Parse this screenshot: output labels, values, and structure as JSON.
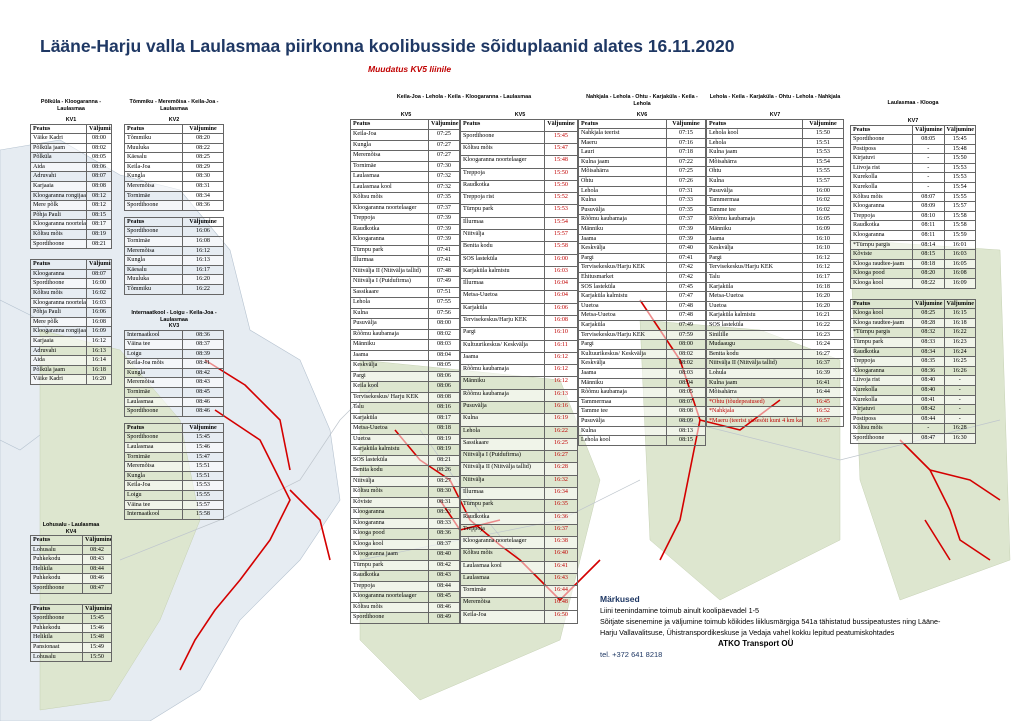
{
  "title": "Lääne-Harju valla Laulasmaa piirkonna koolibusside sõiduplaanid alates 16.11.2020",
  "subtitle": "Muudatus KV5 liinile",
  "col": {
    "stop": "Peatus",
    "dep": "Väljumine"
  },
  "kv1": {
    "route": "Põlküla - Kloogaranna - Laulasmaa",
    "code": "KV1",
    "rows": [
      [
        "Väike Kadri",
        "08:00"
      ],
      [
        "Põlküla jaam",
        "08:02"
      ],
      [
        "Põlküla",
        "08:05"
      ],
      [
        "Aida",
        "08:06"
      ],
      [
        "Adruvahi",
        "08:07"
      ],
      [
        "Karjaaia",
        "08:08"
      ],
      [
        "Kloogaranna rongijaam",
        "08:12"
      ],
      [
        "Mere põlk",
        "08:12"
      ],
      [
        "Põhja Pauli",
        "08:15"
      ],
      [
        "Kloogaranna noortelaager",
        "08:17"
      ],
      [
        "Kõltsu mõis",
        "08:19"
      ],
      [
        "Spordihoone",
        "08:21"
      ]
    ]
  },
  "kv1b": {
    "rows": [
      [
        "Kloogaranna",
        "08:07"
      ],
      [
        "Spordihoone",
        "16:00"
      ],
      [
        "Kõltsu mõis",
        "16:02"
      ],
      [
        "Kloogaranna noortelaager",
        "16:03"
      ],
      [
        "Põhja Pauli",
        "16:06"
      ],
      [
        "Mere põlk",
        "16:08"
      ],
      [
        "Kloogaranna rongijaam",
        "16:09"
      ],
      [
        "Karjaaia",
        "16:12"
      ],
      [
        "Adruvahi",
        "16:13"
      ],
      [
        "Aida",
        "16:14"
      ],
      [
        "Põlküla jaam",
        "16:18"
      ],
      [
        "Väike Kadri",
        "16:20"
      ]
    ]
  },
  "kv4": {
    "route": "Lohusalu - Laulasmaa",
    "code": "KV4",
    "rows": [
      [
        "Lohusalu",
        "08:42"
      ],
      [
        "Puhkekodu",
        "08:43"
      ],
      [
        "Helikila",
        "08:44"
      ],
      [
        "Puhkekodu",
        "08:46"
      ],
      [
        "Spordihoone",
        "08:47"
      ]
    ],
    "rows2": [
      [
        "Spordihoone",
        "15:45"
      ],
      [
        "Puhkekodu",
        "15:46"
      ],
      [
        "Helikila",
        "15:48"
      ],
      [
        "Pansionaat",
        "15:49"
      ],
      [
        "Lohusalu",
        "15:50"
      ]
    ]
  },
  "kv2": {
    "route": "Tõmmiku - Meremõisa - Keila-Joa - Laulasmaa",
    "code": "KV2",
    "rows": [
      [
        "Tõmmiku",
        "08:20"
      ],
      [
        "Muuluka",
        "08:22"
      ],
      [
        "Käesalu",
        "08:25"
      ],
      [
        "Keila-Joa",
        "08:29"
      ],
      [
        "Kungla",
        "08:30"
      ],
      [
        "Meremõisa",
        "08:31"
      ],
      [
        "Tornimäe",
        "08:34"
      ],
      [
        "Spordihoone",
        "08:36"
      ]
    ],
    "rows2": [
      [
        "Spordihoone",
        "16:06"
      ],
      [
        "Tornimäe",
        "16:08"
      ],
      [
        "Meremõisa",
        "16:12"
      ],
      [
        "Kungla",
        "16:13"
      ],
      [
        "Käesalu",
        "16:17"
      ],
      [
        "Muuluka",
        "16:20"
      ],
      [
        "Tõmmiku",
        "16:22"
      ]
    ]
  },
  "kv3": {
    "route": "Internaatkool - Loigu - Keila-Joa - Laulasmaa",
    "code": "KV3",
    "rows": [
      [
        "Internaatkool",
        "08:36"
      ],
      [
        "Väina tee",
        "08:37"
      ],
      [
        "Loigu",
        "08:39"
      ],
      [
        "Keila-Joa mõis",
        "08:41"
      ],
      [
        "Kungla",
        "08:42"
      ],
      [
        "Meremõisa",
        "08:43"
      ],
      [
        "Tornimäe",
        "08:45"
      ],
      [
        "Laulasmaa",
        "08:46"
      ],
      [
        "Spordihoone",
        "08:46"
      ]
    ],
    "rows2": [
      [
        "Spordihoone",
        "15:45"
      ],
      [
        "Laulasmaa",
        "15:46"
      ],
      [
        "Tornimäe",
        "15:47"
      ],
      [
        "Meremõisa",
        "15:51"
      ],
      [
        "Kungla",
        "15:51"
      ],
      [
        "Keila-Joa",
        "15:53"
      ],
      [
        "Loigu",
        "15:55"
      ],
      [
        "Väina tee",
        "15:57"
      ],
      [
        "Internaatkool",
        "15:58"
      ]
    ]
  },
  "kv5": {
    "route": "Keila-Joa - Lehola - Keila - Kloogaranna - Laulasmaa",
    "code": "KV5",
    "rows": [
      [
        "Keila-Joa",
        "07:25"
      ],
      [
        "Kungla",
        "07:27"
      ],
      [
        "Meremõisa",
        "07:27"
      ],
      [
        "Tornimäe",
        "07:30"
      ],
      [
        "Laulasmaa",
        "07:32"
      ],
      [
        "Laulasmaa kool",
        "07:32"
      ],
      [
        "Kõltsu mõis",
        "07:35"
      ],
      [
        "Kloogaranna noortelaager",
        "07:37"
      ],
      [
        "Treppoja",
        "07:39"
      ],
      [
        "Raudkotka",
        "07:39"
      ],
      [
        "Kloogaranna",
        "07:39"
      ],
      [
        "Türnpu park",
        "07:41"
      ],
      [
        "Illurmaa",
        "07:41"
      ],
      [
        "Niitvälja II (Niitvälja tallid)",
        "07:48"
      ],
      [
        "Niitvälja I (Puidufirma)",
        "07:49"
      ],
      [
        "Sassikaare",
        "07:51"
      ],
      [
        "Lehola",
        "07:55"
      ],
      [
        "Kulna",
        "07:56"
      ],
      [
        "Pusuvälja",
        "08:00"
      ],
      [
        "Rõõmu kaubamaja",
        "08:02"
      ],
      [
        "Männiku",
        "08:03"
      ],
      [
        "Jaama",
        "08:04"
      ],
      [
        "Keskvälja",
        "08:05"
      ],
      [
        "Pargi",
        "08:06"
      ],
      [
        "Keila kool",
        "08:06"
      ],
      [
        "Tervisekeskus/ Harju KEK",
        "08:08"
      ],
      [
        "Talu",
        "08:16"
      ],
      [
        "Karjaküla",
        "08:17"
      ],
      [
        "Metsa-Uuetoa",
        "08:18"
      ],
      [
        "Uuetoa",
        "08:19"
      ],
      [
        "Karjaküla kalmistu",
        "08:19"
      ],
      [
        "SOS lasteküla",
        "08:21"
      ],
      [
        "Benita kodu",
        "08:26"
      ],
      [
        "Niitvälja",
        "08:27"
      ],
      [
        "Kõltsu mõis",
        "08:30"
      ],
      [
        "Kõviste",
        "08:31"
      ],
      [
        "Kloogaranna",
        "08:33"
      ],
      [
        "Kloogaranna",
        "08:33"
      ],
      [
        "Klooga pood",
        "08:36"
      ],
      [
        "Klooga kool",
        "08:37"
      ],
      [
        "Kloogaranna jaam",
        "08:40"
      ],
      [
        "Türnpu park",
        "08:42"
      ],
      [
        "Raudkotka",
        "08:43"
      ],
      [
        "Treppoja",
        "08:44"
      ],
      [
        "Kloogaranna noortelaager",
        "08:45"
      ],
      [
        "Kõltsu mõis",
        "08:46"
      ],
      [
        "Spordihoone",
        "08:49"
      ]
    ],
    "rows2": [
      [
        "Spordihoone",
        "15:45"
      ],
      [
        "Kõltsu mõis",
        "15:47"
      ],
      [
        "Kloogaranna noortelaager",
        "15:48"
      ],
      [
        "Treppoja",
        "15:50"
      ],
      [
        "Raudkotka",
        "15:50"
      ],
      [
        "Treppoja rist",
        "15:52"
      ],
      [
        "Türnpu park",
        "15:53"
      ],
      [
        "Illurmaa",
        "15:54"
      ],
      [
        "Niitvälja",
        "15:57"
      ],
      [
        "Benita kodu",
        "15:58"
      ],
      [
        "SOS lasteküla",
        "16:00"
      ],
      [
        "Karjaküla kalmistu",
        "16:03"
      ],
      [
        "Illurmaa",
        "16:04"
      ],
      [
        "Metsa-Uuetoa",
        "16:04"
      ],
      [
        "Karjaküla",
        "16:06"
      ],
      [
        "Tervisekeskus/Harju KEK",
        "16:08"
      ],
      [
        "Pargi",
        "16:10"
      ],
      [
        "Kultuurikeskus/ Keskvälja",
        "16:11"
      ],
      [
        "Jaama",
        "16:12"
      ],
      [
        "Rõõmu kaubamaja",
        "16:12"
      ],
      [
        "Männiku",
        "16:12"
      ],
      [
        "Rõõmu kaubamaja",
        "16:13"
      ],
      [
        "Pusuvälja",
        "16:16"
      ],
      [
        "Kulna",
        "16:19"
      ],
      [
        "Lehola",
        "16:22"
      ],
      [
        "Sassikaare",
        "16:25"
      ],
      [
        "Niitvälja I (Puidufirma)",
        "16:27"
      ],
      [
        "Niitvälja II (Niitvälja tallid)",
        "16:28"
      ],
      [
        "Niitvälja",
        "16:32"
      ],
      [
        "Illurmaa",
        "16:34"
      ],
      [
        "Türnpu park",
        "16:35"
      ],
      [
        "Raudkotka",
        "16:36"
      ],
      [
        "Treppoja",
        "16:37"
      ],
      [
        "Kloogaranna noortelaager",
        "16:38"
      ],
      [
        "Kõltsu mõis",
        "16:40"
      ],
      [
        "Laulasmaa kool",
        "16:41"
      ],
      [
        "Laulasmaa",
        "16:43"
      ],
      [
        "Tornimäe",
        "16:44"
      ],
      [
        "Meremõisa",
        "16:48"
      ],
      [
        "Keila-Joa",
        "16:50"
      ]
    ]
  },
  "kv6": {
    "route": "Nahkjala - Lehola - Ohtu - Karjaküla - Keila - Lehola",
    "code": "KV6",
    "rows": [
      [
        "Nahkjala teerist",
        "07:15"
      ],
      [
        "Maeru",
        "07:16"
      ],
      [
        "Lauri",
        "07:18"
      ],
      [
        "Kulna jaam",
        "07:22"
      ],
      [
        "Mõisahärra",
        "07:25"
      ],
      [
        "Ohtu",
        "07:26"
      ],
      [
        "Lehola",
        "07:31"
      ],
      [
        "Kulna",
        "07:33"
      ],
      [
        "Pusuvälja",
        "07:35"
      ],
      [
        "Rõõmu kaubamaja",
        "07:37"
      ],
      [
        "Männiku",
        "07:39"
      ],
      [
        "Jaama",
        "07:39"
      ],
      [
        "Keskvälja",
        "07:40"
      ],
      [
        "Pargi",
        "07:41"
      ],
      [
        "Tervisekeskus/Harju KEK",
        "07:42"
      ],
      [
        "Ehitusmarket",
        "07:42"
      ],
      [
        "SOS lasteküla",
        "07:45"
      ],
      [
        "Karjaküla kalmistu",
        "07:47"
      ],
      [
        "Uuetoa",
        "07:48"
      ],
      [
        "Metsa-Uuetoa",
        "07:48"
      ],
      [
        "Karjaküla",
        "07:49"
      ],
      [
        "Tervisekeskus/Harju KEK",
        "07:59"
      ],
      [
        "Pargi",
        "08:00"
      ],
      [
        "Kultuurikeskus/ Keskvälja",
        "08:02"
      ],
      [
        "Keskvälja",
        "08:02"
      ],
      [
        "Jaama",
        "08:03"
      ],
      [
        "Männiku",
        "08:04"
      ],
      [
        "Rõõmu kaubamaja",
        "08:05"
      ],
      [
        "Tammermaa",
        "08:07"
      ],
      [
        "Tamme tee",
        "08:08"
      ],
      [
        "Pusuvälja",
        "08:09"
      ],
      [
        "Kulna",
        "08:13"
      ],
      [
        "Lehola kool",
        "08:15"
      ]
    ]
  },
  "kv7": {
    "route": "Lehola - Keila - Karjaküla - Ohtu - Lehola - Nahkjala",
    "code": "KV7",
    "rows": [
      [
        "Lehola kool",
        "15:50"
      ],
      [
        "Lehola",
        "15:51"
      ],
      [
        "Kulna jaam",
        "15:53"
      ],
      [
        "Mõisahärra",
        "15:54"
      ],
      [
        "Ohtu",
        "15:55"
      ],
      [
        "Kulna",
        "15:57"
      ],
      [
        "Pusuvälja",
        "16:00"
      ],
      [
        "Tammermaa",
        "16:02"
      ],
      [
        "Tamme tee",
        "16:02"
      ],
      [
        "Rõõmu kaubamaja",
        "16:05"
      ],
      [
        "Männiku",
        "16:09"
      ],
      [
        "Jaama",
        "16:10"
      ],
      [
        "Keskvälja",
        "16:10"
      ],
      [
        "Pargi",
        "16:12"
      ],
      [
        "Tervisekeskus/Harju KEK",
        "16:12"
      ],
      [
        "Talu",
        "16:17"
      ],
      [
        "Karjaküla",
        "16:18"
      ],
      [
        "Metsa-Uuetoa",
        "16:20"
      ],
      [
        "Uuetoa",
        "16:20"
      ],
      [
        "Karjaküla kalmistu",
        "16:21"
      ],
      [
        "SOS lasteküla",
        "16:22"
      ],
      [
        "Sinilille",
        "16:23"
      ],
      [
        "Mudaaugu",
        "16:24"
      ],
      [
        "Benita kodu",
        "16:27"
      ],
      [
        "Niitvälja II (Niitvälja tallid)",
        "16:37"
      ],
      [
        "Lohula",
        "16:39"
      ],
      [
        "Kulna jaam",
        "16:41"
      ],
      [
        "Mõisahärra",
        "16:44"
      ],
      [
        "*Ohtu (tõudepeatused)",
        "16:45"
      ],
      [
        "*Nahkjala",
        "16:52"
      ],
      [
        "*Maeru (teerist sissesõit kuni 4 km kaugusele)",
        "16:57"
      ]
    ]
  },
  "kv8": {
    "route": "Laulasmaa - Klooga",
    "code": "KV7",
    "rows": [
      [
        "Spordihoone",
        "08:05",
        "15:45"
      ],
      [
        "Postiposs",
        "-",
        "15:48"
      ],
      [
        "Kirjatuvi",
        "-",
        "15:50"
      ],
      [
        "Liivoja rist",
        "-",
        "15:53"
      ],
      [
        "Kurekolla",
        "-",
        "15:53"
      ],
      [
        "Kurekolla",
        "-",
        "15:54"
      ],
      [
        "Kõltsu mõis",
        "08:07",
        "15:55"
      ],
      [
        "Kloogaranna",
        "08:09",
        "15:57"
      ],
      [
        "Treppoja",
        "08:10",
        "15:58"
      ],
      [
        "Raudkotka",
        "08:11",
        "15:58"
      ],
      [
        "Kloogaranna",
        "08:11",
        "15:59"
      ],
      [
        "*Türnpu pargis",
        "08:14",
        "16:01"
      ],
      [
        "Kõviste",
        "08:15",
        "16:03"
      ],
      [
        "Klooga raudtee-jaam",
        "08:18",
        "16:05"
      ],
      [
        "Klooga pood",
        "08:20",
        "16:08"
      ],
      [
        "Klooga kool",
        "08:22",
        "16:09"
      ]
    ],
    "rows2": [
      [
        "Klooga kool",
        "08:25",
        "16:15"
      ],
      [
        "Klooga raudtee-jaam",
        "08:28",
        "16:18"
      ],
      [
        "*Türnpu pargis",
        "08:32",
        "16:22"
      ],
      [
        "Türnpu park",
        "08:33",
        "16:23"
      ],
      [
        "Raudkotka",
        "08:34",
        "16:24"
      ],
      [
        "Treppoja",
        "08:35",
        "16:25"
      ],
      [
        "Kloogaranna",
        "08:36",
        "16:26"
      ],
      [
        "Liivoja rist",
        "08:40",
        "-"
      ],
      [
        "Kurekolla",
        "08:40",
        "-"
      ],
      [
        "Kurekolla",
        "08:41",
        "-"
      ],
      [
        "Kirjatuvi",
        "08:42",
        "-"
      ],
      [
        "Postiposs",
        "08:44",
        "-"
      ],
      [
        "Kõltsu mõis",
        "-",
        "16:28"
      ],
      [
        "Spordihoone",
        "08:47",
        "16:30"
      ]
    ]
  },
  "notes": {
    "heading": "Märkused",
    "l1": "Liini teenindamine toimub ainult koolipäevadel 1-5",
    "l2": "Sõitjate sisenemine ja väljumine toimub kõikides liiklusmärgiga 541a tähistatud bussipeatustes ning Lääne-",
    "l3": "Harju Vallavalitsuse, Ühistranspordikeskuse ja Vedaja vahel kokku lepitud peatumiskohtades",
    "company": "ATKO Transport OÜ",
    "tel": "tel. +372 641 8218"
  },
  "colors": {
    "title": "#1f3864",
    "change": "#c00000",
    "route": "#d40000"
  }
}
